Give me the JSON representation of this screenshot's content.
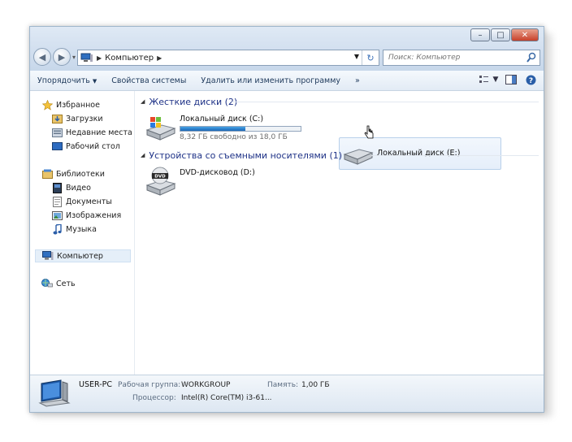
{
  "window": {
    "address": {
      "location": "Компьютер"
    },
    "search": {
      "placeholder": "Поиск: Компьютер"
    }
  },
  "toolbar": {
    "organize": "Упорядочить",
    "system_properties": "Свойства системы",
    "uninstall": "Удалить или изменить программу",
    "more": "»"
  },
  "navpane": {
    "favorites": "Избранное",
    "downloads": "Загрузки",
    "recent": "Недавние места",
    "desktop": "Рабочий стол",
    "libraries": "Библиотеки",
    "video": "Видео",
    "documents": "Документы",
    "images": "Изображения",
    "music": "Музыка",
    "computer": "Компьютер",
    "network": "Сеть"
  },
  "content": {
    "hard_drives_header": "Жесткие диски (2)",
    "removable_header": "Устройства со съемными носителями (1)",
    "drives": [
      {
        "name": "Локальный диск (C:)",
        "free": "8,32 ГБ свободно из 18,0 ГБ",
        "used_fraction": 0.54
      },
      {
        "name": "Локальный диск (E:)"
      }
    ],
    "removable": [
      {
        "name": "DVD-дисковод (D:)"
      }
    ]
  },
  "details": {
    "pc_name": "USER-PC",
    "workgroup_label": "Рабочая группа:",
    "workgroup_value": "WORKGROUP",
    "memory_label": "Память:",
    "memory_value": "1,00 ГБ",
    "cpu_label": "Процессор:",
    "cpu_value": "Intel(R) Core(TM) i3-61..."
  }
}
